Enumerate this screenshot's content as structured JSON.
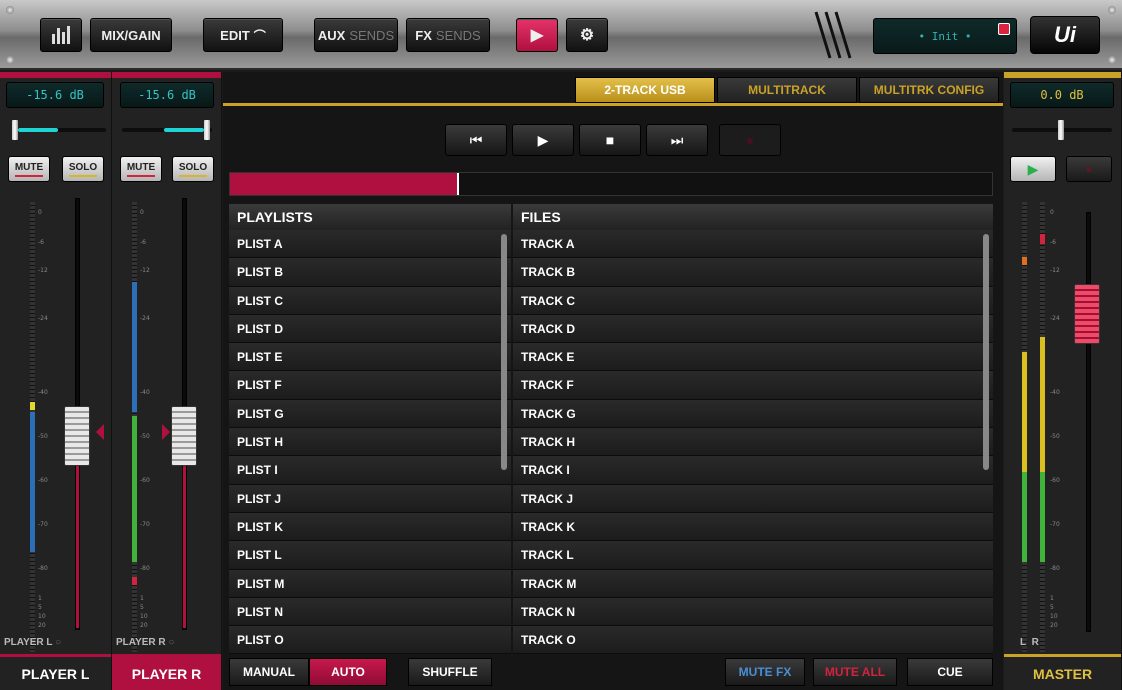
{
  "toolbar": {
    "mixgain_label": "MIX/GAIN",
    "edit_label": "EDIT",
    "aux_label_a": "AUX",
    "aux_label_b": "SENDS",
    "fx_label_a": "FX",
    "fx_label_b": "SENDS",
    "display_text": "• Init •",
    "logo_text": "Ui"
  },
  "channels": [
    {
      "name": "PLAYER L",
      "tag": "PLAYER L",
      "gain": "-15.6 dB",
      "mute": "MUTE",
      "solo": "SOLO"
    },
    {
      "name": "PLAYER R",
      "tag": "PLAYER R",
      "gain": "-15.6 dB",
      "mute": "MUTE",
      "solo": "SOLO"
    }
  ],
  "meter_scale": [
    "0",
    "-6",
    "-12",
    "-24",
    "-40",
    "-50",
    "-60",
    "-70",
    "-80",
    "1",
    "5",
    "10",
    "20"
  ],
  "tabs": [
    {
      "label": "2-TRACK USB",
      "active": true
    },
    {
      "label": "MULTITRACK",
      "active": false
    },
    {
      "label": "MULTITRK CONFIG",
      "active": false
    }
  ],
  "transport": {
    "prev": "⏮",
    "play": "▶",
    "stop": "■",
    "next": "⏭",
    "record": "●"
  },
  "progress": 0.3,
  "playlists": {
    "header": "PLAYLISTS",
    "items": [
      "PLIST A",
      "PLIST B",
      "PLIST C",
      "PLIST D",
      "PLIST E",
      "PLIST F",
      "PLIST G",
      "PLIST H",
      "PLIST I",
      "PLIST J",
      "PLIST K",
      "PLIST L",
      "PLIST M",
      "PLIST N",
      "PLIST O"
    ]
  },
  "files": {
    "header": "FILES",
    "items": [
      "TRACK A",
      "TRACK B",
      "TRACK C",
      "TRACK D",
      "TRACK E",
      "TRACK F",
      "TRACK G",
      "TRACK H",
      "TRACK I",
      "TRACK J",
      "TRACK K",
      "TRACK L",
      "TRACK M",
      "TRACK N",
      "TRACK O"
    ]
  },
  "play_modes": {
    "manual": "MANUAL",
    "auto": "AUTO",
    "shuffle": "SHUFFLE"
  },
  "bottom_actions": {
    "mute_fx": "MUTE FX",
    "mute_all": "MUTE ALL",
    "cue": "CUE"
  },
  "master": {
    "name": "MASTER",
    "gain": "0.0 dB",
    "meter_l": "L",
    "meter_r": "R"
  },
  "colors": {
    "accent_red": "#b0103f",
    "accent_gold": "#c9a227",
    "lcd_cyan": "#31c6c6",
    "mute_fx_blue": "#4a8fd6",
    "mute_all_red": "#d0243f"
  }
}
